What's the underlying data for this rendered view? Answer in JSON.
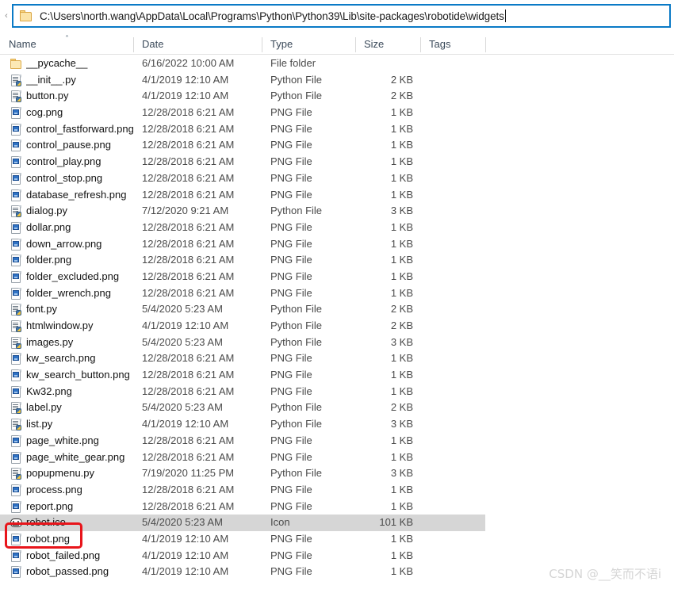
{
  "window": {
    "address_bar": {
      "path": "C:\\Users\\north.wang\\AppData\\Local\\Programs\\Python\\Python39\\Lib\\site-packages\\robotide\\widgets",
      "back_chevron": "‹",
      "folder_icon": "folder-icon"
    }
  },
  "columns": {
    "name": "Name",
    "date": "Date",
    "type": "Type",
    "size": "Size",
    "tags": "Tags",
    "sort_indicator": "˄",
    "sort_column": "Name",
    "sort_direction": "ascending"
  },
  "files": [
    {
      "name": "__pycache__",
      "date": "6/16/2022 10:00 AM",
      "type": "File folder",
      "size": "",
      "tags": "",
      "icon": "folder",
      "selected": false
    },
    {
      "name": "__init__.py",
      "date": "4/1/2019 12:10 AM",
      "type": "Python File",
      "size": "2 KB",
      "tags": "",
      "icon": "py",
      "selected": false
    },
    {
      "name": "button.py",
      "date": "4/1/2019 12:10 AM",
      "type": "Python File",
      "size": "2 KB",
      "tags": "",
      "icon": "py",
      "selected": false
    },
    {
      "name": "cog.png",
      "date": "12/28/2018 6:21 AM",
      "type": "PNG File",
      "size": "1 KB",
      "tags": "",
      "icon": "png",
      "selected": false
    },
    {
      "name": "control_fastforward.png",
      "date": "12/28/2018 6:21 AM",
      "type": "PNG File",
      "size": "1 KB",
      "tags": "",
      "icon": "png",
      "selected": false
    },
    {
      "name": "control_pause.png",
      "date": "12/28/2018 6:21 AM",
      "type": "PNG File",
      "size": "1 KB",
      "tags": "",
      "icon": "png",
      "selected": false
    },
    {
      "name": "control_play.png",
      "date": "12/28/2018 6:21 AM",
      "type": "PNG File",
      "size": "1 KB",
      "tags": "",
      "icon": "png",
      "selected": false
    },
    {
      "name": "control_stop.png",
      "date": "12/28/2018 6:21 AM",
      "type": "PNG File",
      "size": "1 KB",
      "tags": "",
      "icon": "png",
      "selected": false
    },
    {
      "name": "database_refresh.png",
      "date": "12/28/2018 6:21 AM",
      "type": "PNG File",
      "size": "1 KB",
      "tags": "",
      "icon": "png",
      "selected": false
    },
    {
      "name": "dialog.py",
      "date": "7/12/2020 9:21 AM",
      "type": "Python File",
      "size": "3 KB",
      "tags": "",
      "icon": "py",
      "selected": false
    },
    {
      "name": "dollar.png",
      "date": "12/28/2018 6:21 AM",
      "type": "PNG File",
      "size": "1 KB",
      "tags": "",
      "icon": "png",
      "selected": false
    },
    {
      "name": "down_arrow.png",
      "date": "12/28/2018 6:21 AM",
      "type": "PNG File",
      "size": "1 KB",
      "tags": "",
      "icon": "png",
      "selected": false
    },
    {
      "name": "folder.png",
      "date": "12/28/2018 6:21 AM",
      "type": "PNG File",
      "size": "1 KB",
      "tags": "",
      "icon": "png",
      "selected": false
    },
    {
      "name": "folder_excluded.png",
      "date": "12/28/2018 6:21 AM",
      "type": "PNG File",
      "size": "1 KB",
      "tags": "",
      "icon": "png",
      "selected": false
    },
    {
      "name": "folder_wrench.png",
      "date": "12/28/2018 6:21 AM",
      "type": "PNG File",
      "size": "1 KB",
      "tags": "",
      "icon": "png",
      "selected": false
    },
    {
      "name": "font.py",
      "date": "5/4/2020 5:23 AM",
      "type": "Python File",
      "size": "2 KB",
      "tags": "",
      "icon": "py",
      "selected": false
    },
    {
      "name": "htmlwindow.py",
      "date": "4/1/2019 12:10 AM",
      "type": "Python File",
      "size": "2 KB",
      "tags": "",
      "icon": "py",
      "selected": false
    },
    {
      "name": "images.py",
      "date": "5/4/2020 5:23 AM",
      "type": "Python File",
      "size": "3 KB",
      "tags": "",
      "icon": "py",
      "selected": false
    },
    {
      "name": "kw_search.png",
      "date": "12/28/2018 6:21 AM",
      "type": "PNG File",
      "size": "1 KB",
      "tags": "",
      "icon": "png",
      "selected": false
    },
    {
      "name": "kw_search_button.png",
      "date": "12/28/2018 6:21 AM",
      "type": "PNG File",
      "size": "1 KB",
      "tags": "",
      "icon": "png",
      "selected": false
    },
    {
      "name": "Kw32.png",
      "date": "12/28/2018 6:21 AM",
      "type": "PNG File",
      "size": "1 KB",
      "tags": "",
      "icon": "png",
      "selected": false
    },
    {
      "name": "label.py",
      "date": "5/4/2020 5:23 AM",
      "type": "Python File",
      "size": "2 KB",
      "tags": "",
      "icon": "py",
      "selected": false
    },
    {
      "name": "list.py",
      "date": "4/1/2019 12:10 AM",
      "type": "Python File",
      "size": "3 KB",
      "tags": "",
      "icon": "py",
      "selected": false
    },
    {
      "name": "page_white.png",
      "date": "12/28/2018 6:21 AM",
      "type": "PNG File",
      "size": "1 KB",
      "tags": "",
      "icon": "png",
      "selected": false
    },
    {
      "name": "page_white_gear.png",
      "date": "12/28/2018 6:21 AM",
      "type": "PNG File",
      "size": "1 KB",
      "tags": "",
      "icon": "png",
      "selected": false
    },
    {
      "name": "popupmenu.py",
      "date": "7/19/2020 11:25 PM",
      "type": "Python File",
      "size": "3 KB",
      "tags": "",
      "icon": "py",
      "selected": false
    },
    {
      "name": "process.png",
      "date": "12/28/2018 6:21 AM",
      "type": "PNG File",
      "size": "1 KB",
      "tags": "",
      "icon": "png",
      "selected": false
    },
    {
      "name": "report.png",
      "date": "12/28/2018 6:21 AM",
      "type": "PNG File",
      "size": "1 KB",
      "tags": "",
      "icon": "png",
      "selected": false
    },
    {
      "name": "robot.ico",
      "date": "5/4/2020 5:23 AM",
      "type": "Icon",
      "size": "101 KB",
      "tags": "",
      "icon": "ico",
      "selected": true
    },
    {
      "name": "robot.png",
      "date": "4/1/2019 12:10 AM",
      "type": "PNG File",
      "size": "1 KB",
      "tags": "",
      "icon": "png",
      "selected": false
    },
    {
      "name": "robot_failed.png",
      "date": "4/1/2019 12:10 AM",
      "type": "PNG File",
      "size": "1 KB",
      "tags": "",
      "icon": "png",
      "selected": false
    },
    {
      "name": "robot_passed.png",
      "date": "4/1/2019 12:10 AM",
      "type": "PNG File",
      "size": "1 KB",
      "tags": "",
      "icon": "png",
      "selected": false
    }
  ],
  "annotation": {
    "target_file": "robot.ico",
    "color": "#e8151b",
    "shape": "rounded-rectangle"
  },
  "watermark": {
    "text": "CSDN @__笑而不语i"
  }
}
